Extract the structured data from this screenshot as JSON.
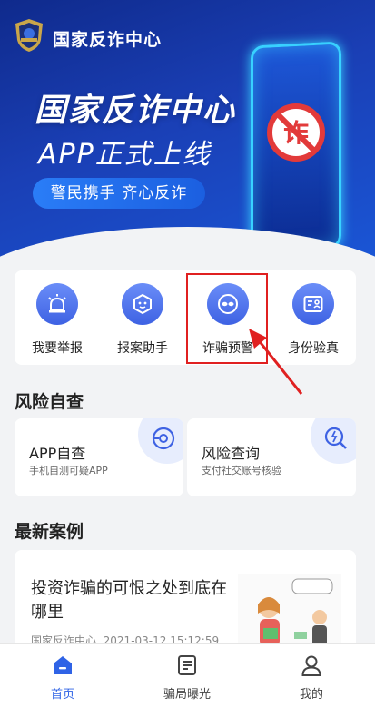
{
  "header": {
    "app_title": "国家反诈中心"
  },
  "banner": {
    "headline": "国家反诈中心",
    "subline": "APP正式上线",
    "slogan": "警民携手   齐心反诈",
    "phone_badge_char": "诈"
  },
  "quick_actions": [
    {
      "label": "我要举报",
      "icon": "siren-icon"
    },
    {
      "label": "报案助手",
      "icon": "assistant-icon"
    },
    {
      "label": "诈骗预警",
      "icon": "mask-icon"
    },
    {
      "label": "身份验真",
      "icon": "id-card-icon"
    }
  ],
  "risk_check": {
    "title": "风险自查",
    "cards": [
      {
        "title": "APP自查",
        "desc": "手机自测可疑APP",
        "icon": "scan-icon"
      },
      {
        "title": "风险查询",
        "desc": "支付社交账号核验",
        "icon": "search-alert-icon"
      }
    ]
  },
  "cases": {
    "title": "最新案例",
    "items": [
      {
        "title": "投资诈骗的可恨之处到底在哪里",
        "source": "国家反诈中心",
        "time": "2021-03-12 15:12:59"
      }
    ]
  },
  "tabbar": {
    "items": [
      {
        "label": "首页",
        "icon": "home-icon",
        "active": true
      },
      {
        "label": "骗局曝光",
        "icon": "document-icon",
        "active": false
      },
      {
        "label": "我的",
        "icon": "user-icon",
        "active": false
      }
    ]
  },
  "colors": {
    "accent": "#2f63e6",
    "banner": "#1a3fb5",
    "highlight": "#e02020"
  }
}
